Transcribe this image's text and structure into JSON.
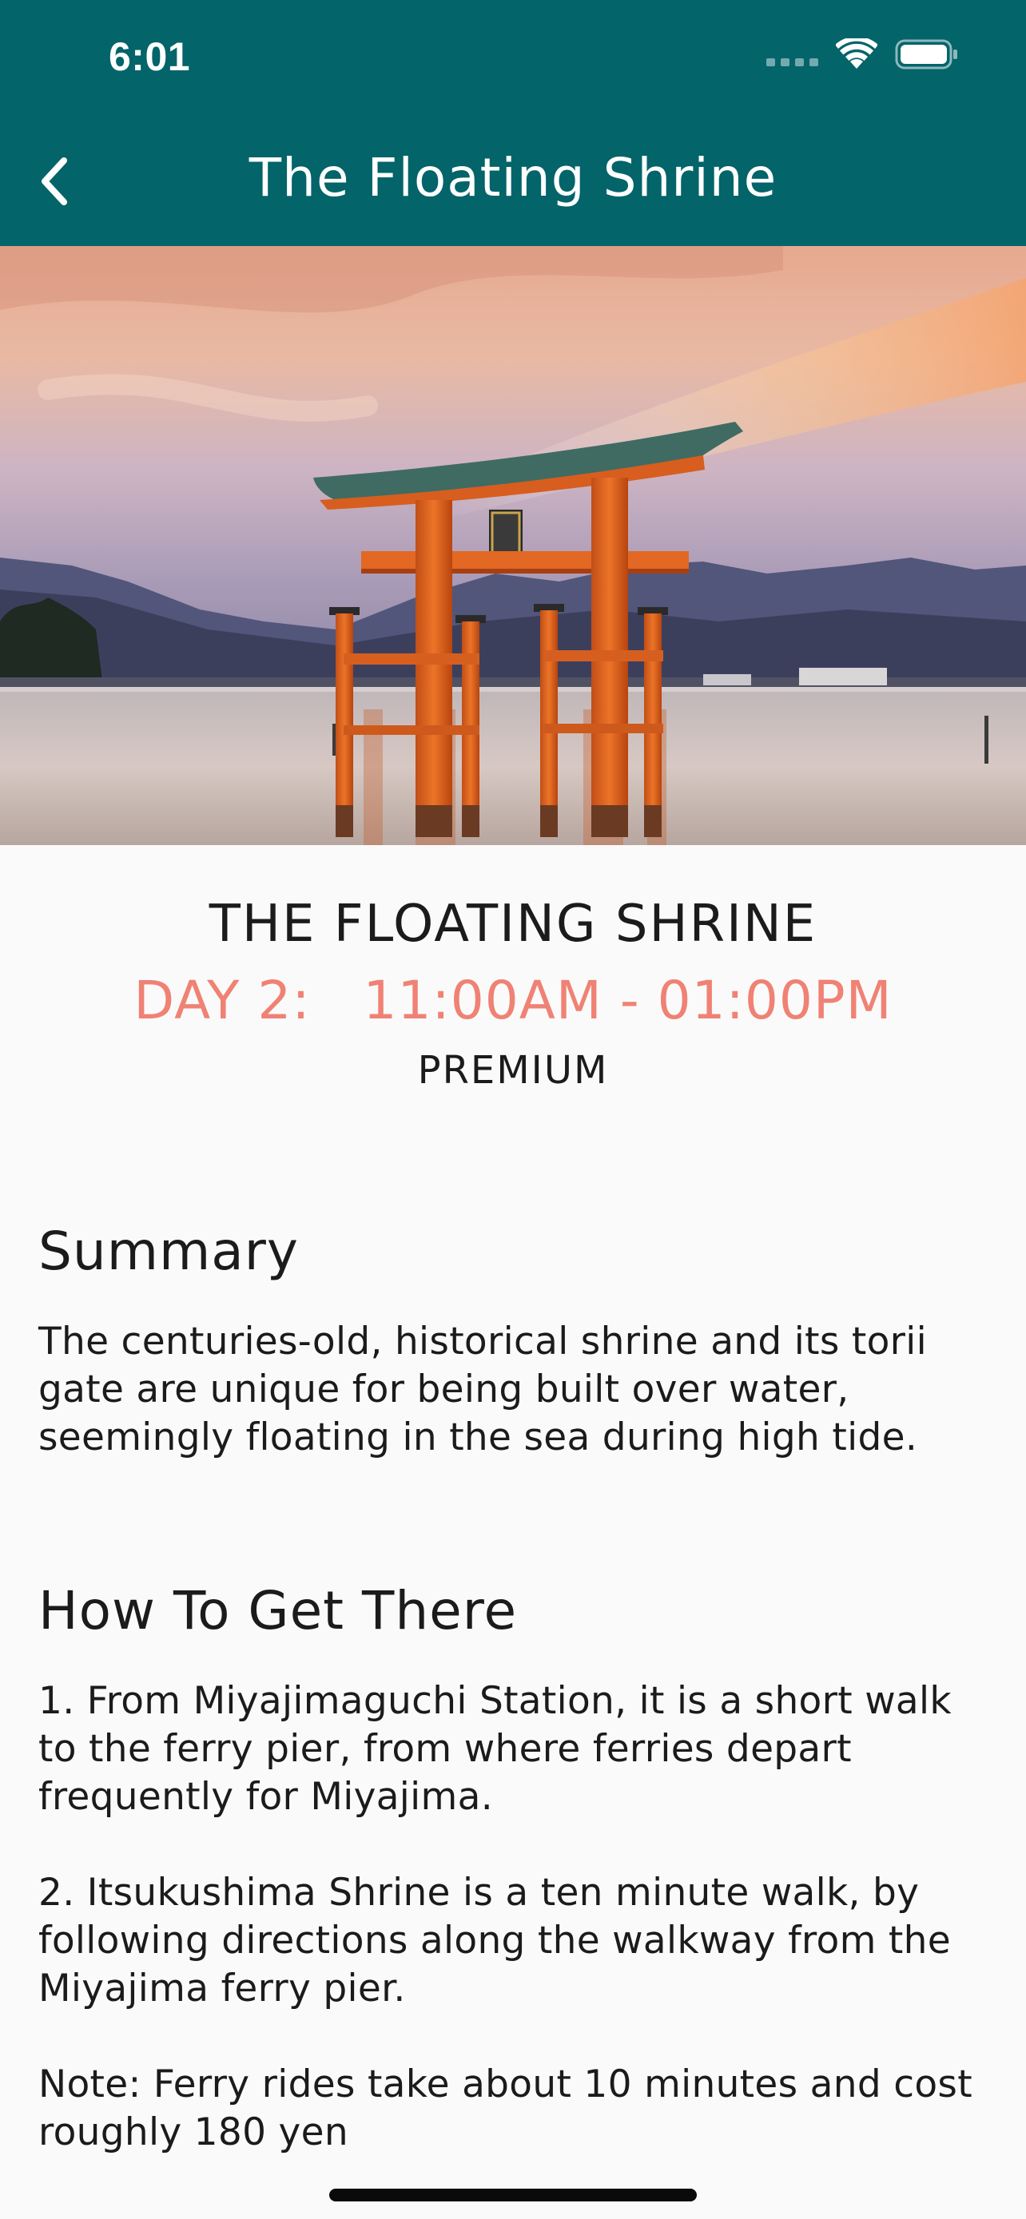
{
  "status_bar": {
    "time": "6:01",
    "icons": [
      "signal-icon",
      "wifi-icon",
      "battery-icon"
    ]
  },
  "nav": {
    "back_icon": "chevron-left-icon",
    "title": "The Floating Shrine"
  },
  "hero": {
    "subject": "torii gate standing in the sea at sunset with mountains behind"
  },
  "event": {
    "title": "THE FLOATING SHRINE",
    "time": "DAY 2:   11:00AM - 01:00PM",
    "tier": "PREMIUM"
  },
  "summary": {
    "heading": "Summary",
    "body": "The centuries-old, historical shrine and its torii gate are unique for being built over water, seemingly floating in the sea during high tide."
  },
  "directions": {
    "heading": "How To Get There",
    "steps": [
      "1.  From Miyajimaguchi Station, it is a short walk to the ferry pier, from where ferries depart frequently for Miyajima.",
      "2.  Itsukushima Shrine is a ten minute walk, by following directions along the walkway from the Miyajima ferry pier."
    ],
    "note": "Note: Ferry rides take about 10 minutes and cost roughly 180 yen"
  },
  "colors": {
    "header_bg": "#03646a",
    "accent_time": "#ef8274",
    "page_bg": "#fafafa",
    "torii": "#e0631e"
  }
}
